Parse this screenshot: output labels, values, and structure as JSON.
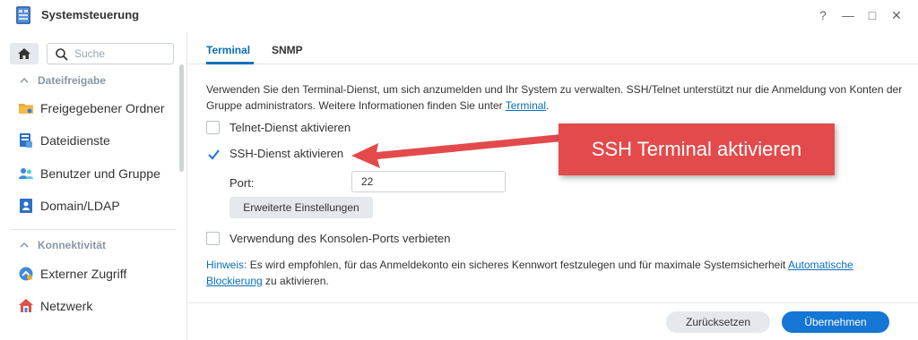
{
  "window": {
    "title": "Systemsteuerung",
    "controls": {
      "help": "?",
      "minimize": "—",
      "maximize": "□",
      "close": "✕"
    }
  },
  "sidebar": {
    "search_placeholder": "Suche",
    "sections": [
      {
        "label": "Dateifreigabe",
        "items": [
          {
            "label": "Freigegebener Ordner",
            "icon": "folder-share-icon"
          },
          {
            "label": "Dateidienste",
            "icon": "file-services-icon"
          },
          {
            "label": "Benutzer und Gruppe",
            "icon": "users-icon"
          },
          {
            "label": "Domain/LDAP",
            "icon": "domain-icon"
          }
        ]
      },
      {
        "label": "Konnektivität",
        "items": [
          {
            "label": "Externer Zugriff",
            "icon": "external-access-icon"
          },
          {
            "label": "Netzwerk",
            "icon": "network-icon"
          }
        ]
      }
    ]
  },
  "tabs": [
    {
      "label": "Terminal",
      "active": true
    },
    {
      "label": "SNMP",
      "active": false
    }
  ],
  "content": {
    "description": "Verwenden Sie den Terminal-Dienst, um sich anzumelden und Ihr System zu verwalten. SSH/Telnet unterstützt nur die Anmeldung von Konten der Gruppe administrators. Weitere Informationen finden Sie unter ",
    "description_link": "Terminal",
    "description_end": ".",
    "telnet_label": "Telnet-Dienst aktivieren",
    "telnet_checked": false,
    "ssh_label": "SSH-Dienst aktivieren",
    "ssh_checked": true,
    "port_label": "Port:",
    "port_value": "22",
    "advanced_button": "Erweiterte Einstellungen",
    "console_label": "Verwendung des Konsolen-Ports verbieten",
    "console_checked": false,
    "hint_label": "Hinweis:",
    "hint_text": " Es wird empfohlen, für das Anmeldekonto ein sicheres Kennwort festzulegen und für maximale Systemsicherheit ",
    "hint_link": "Automatische Blockierung",
    "hint_end": " zu aktivieren."
  },
  "footer": {
    "reset_button": "Zurücksetzen",
    "apply_button": "Übernehmen"
  },
  "callout": {
    "text": "SSH Terminal aktivieren"
  },
  "colors": {
    "accent": "#0a6fb8",
    "primary_button": "#1576d5",
    "callout": "#e34a4b"
  }
}
